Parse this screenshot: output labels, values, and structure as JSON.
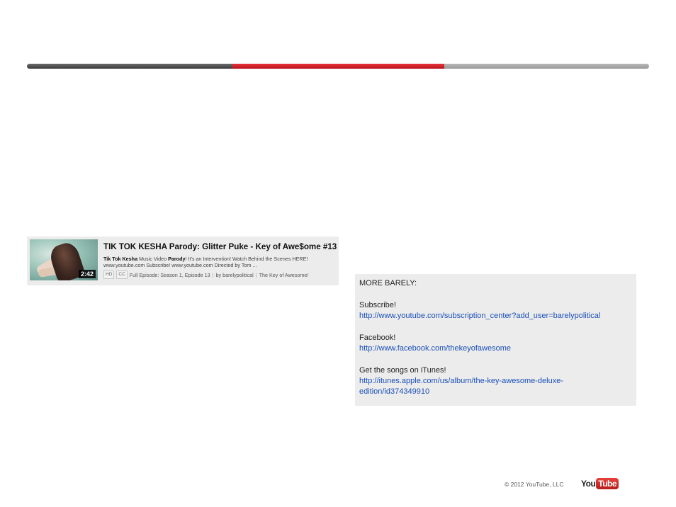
{
  "search_result": {
    "title": "TIK TOK KESHA Parody: Glitter Puke - Key of Awe$ome #13",
    "duration": "2:42",
    "desc_bold_1": "Tik Tok Kesha",
    "desc_part_1": " Music Video ",
    "desc_bold_2": "Parody",
    "desc_part_2": "! It's an Intervention! Watch Behind the Scenes HERE! www.youtube.com Subscribe! www.youtube.com Directed by Tom ...",
    "badge_hd": "HD",
    "badge_cc": "CC",
    "episode": "Full Episode: Season 1, Episode 13",
    "by": "by barelypolitical",
    "channel": "The Key of Awesome!"
  },
  "description_panel": {
    "header": "MORE BARELY:",
    "subscribe_label": "Subscribe!",
    "subscribe_link": "http://www.youtube.com/subscription_center?add_user=barelypolitical",
    "facebook_label": "Facebook!",
    "facebook_link": "http://www.facebook.com/thekeyofawesome",
    "itunes_label": "Get the songs on iTunes!",
    "itunes_link_1": "http://itunes.apple.com/us/album/the-key-awesome-deluxe-",
    "itunes_link_2": "edition/id374349910"
  },
  "footer": {
    "copyright": "© 2012 YouTube, LLC",
    "logo_you": "You",
    "logo_tube": "Tube"
  },
  "colors": {
    "progress_left": "#4a4a4a",
    "progress_mid": "#d8232a",
    "progress_right": "#a8a8a8",
    "link": "#1a4fb8"
  }
}
